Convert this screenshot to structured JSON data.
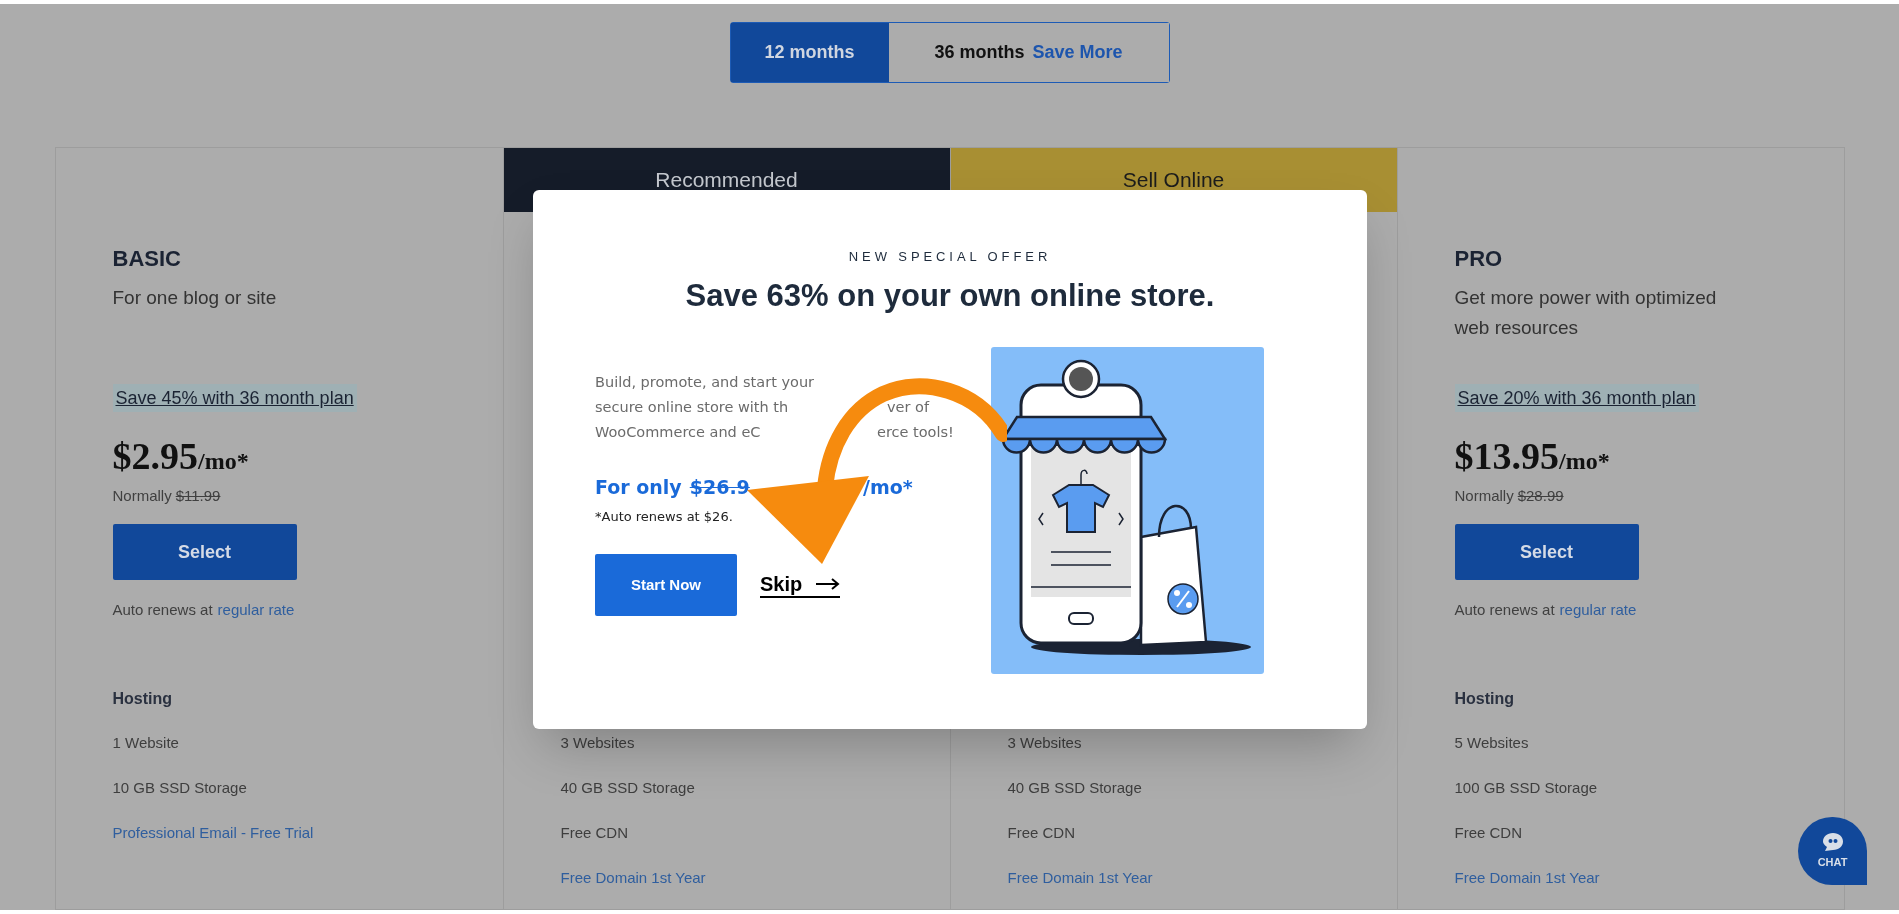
{
  "billing_toggle": [
    {
      "label": "12 months",
      "selected": true
    },
    {
      "label": "36 months",
      "badge": "Save More",
      "selected": false
    }
  ],
  "plans": [
    {
      "kind": "full",
      "name": "BASIC",
      "subtitle": "For one blog or site",
      "save_note": "Save 45% with 36 month plan",
      "price": "$2.95",
      "price_unit": "/mo*",
      "normally_label": "Normally",
      "normal_price": "$11.99",
      "button": "Select",
      "renew_text": "Auto renews at",
      "renew_link": "regular rate",
      "features_heading": "Hosting",
      "features": [
        {
          "text": "1 Website",
          "link": false
        },
        {
          "text": "10 GB SSD Storage",
          "link": false
        },
        {
          "text": "Professional Email - Free Trial",
          "link": true
        }
      ]
    },
    {
      "kind": "covered",
      "banner": "Recommended",
      "color": "#151c29",
      "features": [
        {
          "text": "3 Websites",
          "link": false
        },
        {
          "text": "40 GB SSD Storage",
          "link": false
        },
        {
          "text": "Free CDN",
          "link": false
        },
        {
          "text": "Free Domain 1st Year",
          "link": true
        }
      ]
    },
    {
      "kind": "covered",
      "banner": "Sell Online",
      "color": "#a88f33",
      "features": [
        {
          "text": "3 Websites",
          "link": false
        },
        {
          "text": "40 GB SSD Storage",
          "link": false
        },
        {
          "text": "Free CDN",
          "link": false
        },
        {
          "text": "Free Domain 1st Year",
          "link": true
        }
      ]
    },
    {
      "kind": "full",
      "name": "PRO",
      "subtitle": "Get more power with optimized web resources",
      "save_note": "Save 20% with 36 month plan",
      "price": "$13.95",
      "price_unit": "/mo*",
      "normally_label": "Normally",
      "normal_price": "$28.99",
      "button": "Select",
      "renew_text": "Auto renews at",
      "renew_link": "regular rate",
      "features_heading": "Hosting",
      "features": [
        {
          "text": "5 Websites",
          "link": false
        },
        {
          "text": "100 GB SSD Storage",
          "link": false
        },
        {
          "text": "Free CDN",
          "link": false
        },
        {
          "text": "Free Domain 1st Year",
          "link": true
        }
      ]
    }
  ],
  "modal": {
    "eyebrow": "NEW SPECIAL OFFER",
    "title": "Save 63% on your own online store.",
    "description_lines": [
      [
        "Build, promote, and start your"
      ],
      [
        "secure online store with th",
        "ver of"
      ],
      [
        "WooCommerce and eC",
        "erce tools!"
      ]
    ],
    "price_label": "For only",
    "old_price": "$26.9",
    "price_suffix": "/mo*",
    "renew_note": "*Auto renews at $26.",
    "start_button": "Start Now",
    "skip_link": "Skip"
  },
  "chat_button": {
    "label": "CHAT"
  }
}
